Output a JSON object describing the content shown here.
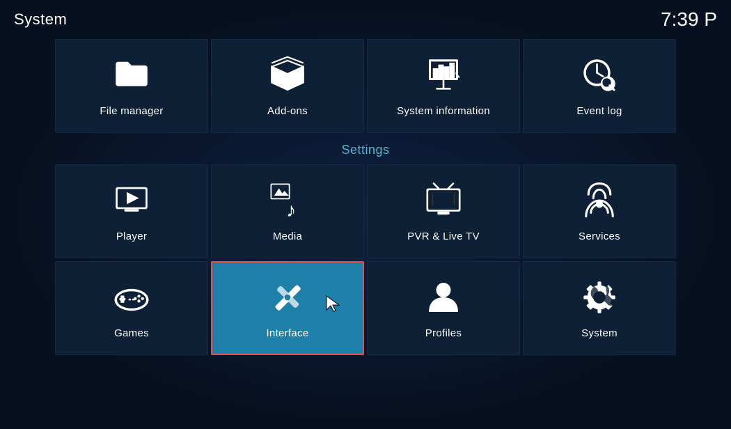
{
  "header": {
    "title": "System",
    "time": "7:39 P"
  },
  "settings_label": "Settings",
  "top_tiles": [
    {
      "id": "file-manager",
      "label": "File manager",
      "icon": "folder"
    },
    {
      "id": "add-ons",
      "label": "Add-ons",
      "icon": "box"
    },
    {
      "id": "system-information",
      "label": "System information",
      "icon": "presentation"
    },
    {
      "id": "event-log",
      "label": "Event log",
      "icon": "clock-search"
    }
  ],
  "mid_tiles": [
    {
      "id": "player",
      "label": "Player",
      "icon": "play"
    },
    {
      "id": "media",
      "label": "Media",
      "icon": "media"
    },
    {
      "id": "pvr-live-tv",
      "label": "PVR & Live TV",
      "icon": "tv"
    },
    {
      "id": "services",
      "label": "Services",
      "icon": "broadcast"
    }
  ],
  "bottom_tiles": [
    {
      "id": "games",
      "label": "Games",
      "icon": "gamepad"
    },
    {
      "id": "interface",
      "label": "Interface",
      "icon": "pencil-ruler",
      "active": true
    },
    {
      "id": "profiles",
      "label": "Profiles",
      "icon": "person"
    },
    {
      "id": "system",
      "label": "System",
      "icon": "gear-wrench"
    }
  ]
}
